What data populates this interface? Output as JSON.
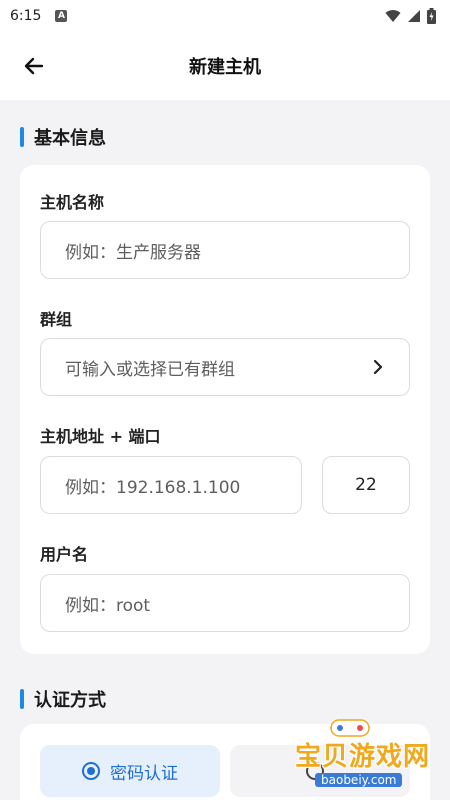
{
  "status_bar": {
    "time": "6:15",
    "notification_icon": "a-icon"
  },
  "app_bar": {
    "title": "新建主机",
    "back_icon": "arrow-left-icon"
  },
  "basic_section": {
    "title": "基本信息",
    "host_name": {
      "label": "主机名称",
      "placeholder": "例如：生产服务器"
    },
    "group": {
      "label": "群组",
      "placeholder": "可输入或选择已有群组"
    },
    "address": {
      "label": "主机地址 + 端口",
      "host_placeholder": "例如：192.168.1.100",
      "port_value": "22"
    },
    "username": {
      "label": "用户名",
      "placeholder": "例如：root"
    }
  },
  "auth_section": {
    "title": "认证方式",
    "options": [
      {
        "label": "密码认证",
        "selected": true
      },
      {
        "label": "",
        "selected": false
      }
    ]
  },
  "watermark": {
    "text": "宝贝游戏网",
    "url": "baobeiy.com"
  },
  "colors": {
    "accent": "#1e88e5",
    "background": "#f3f3f5",
    "card": "#ffffff"
  }
}
